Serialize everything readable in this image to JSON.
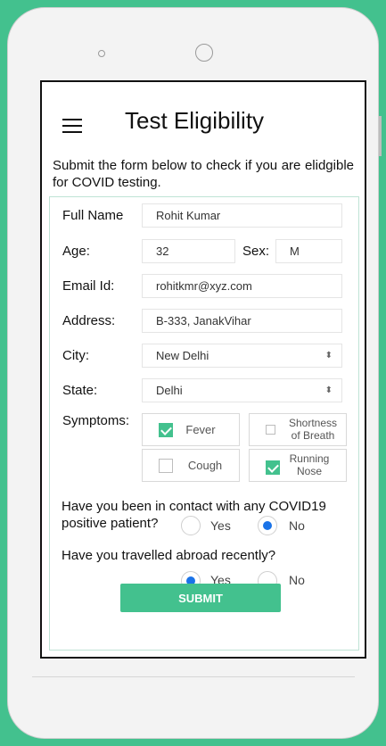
{
  "header": {
    "title": "Test Eligibility"
  },
  "intro": "Submit the form below to check if you are elidgible  for COVID testing.",
  "form": {
    "full_name": {
      "label": "Full Name",
      "value": "Rohit Kumar"
    },
    "age": {
      "label": "Age:",
      "value": "32"
    },
    "sex": {
      "label": "Sex:",
      "value": "M"
    },
    "email": {
      "label": "Email Id:",
      "value": "rohitkmr@xyz.com"
    },
    "address": {
      "label": "Address:",
      "value": "B-333, JanakVihar"
    },
    "city": {
      "label": "City:",
      "value": "New Delhi"
    },
    "state": {
      "label": "State:",
      "value": "Delhi"
    },
    "symptoms": {
      "label": "Symptoms:",
      "items": [
        {
          "label": "Fever",
          "checked": true
        },
        {
          "label": "Shortness of Breath",
          "checked": false
        },
        {
          "label": "Cough",
          "checked": false
        },
        {
          "label": "Running Nose",
          "checked": true
        }
      ]
    },
    "contact_question": {
      "text": "Have you been in contact with any COVID19 positive patient?",
      "options": [
        "Yes",
        "No"
      ],
      "selected": "No"
    },
    "travel_question": {
      "text": "Have you travelled abroad recently?",
      "options": [
        "Yes",
        "No"
      ],
      "selected": "Yes"
    },
    "submit_label": "SUBMIT"
  },
  "colors": {
    "background": "#43c18e",
    "accent": "#43c18e",
    "radio_selected": "#1a73e8"
  }
}
